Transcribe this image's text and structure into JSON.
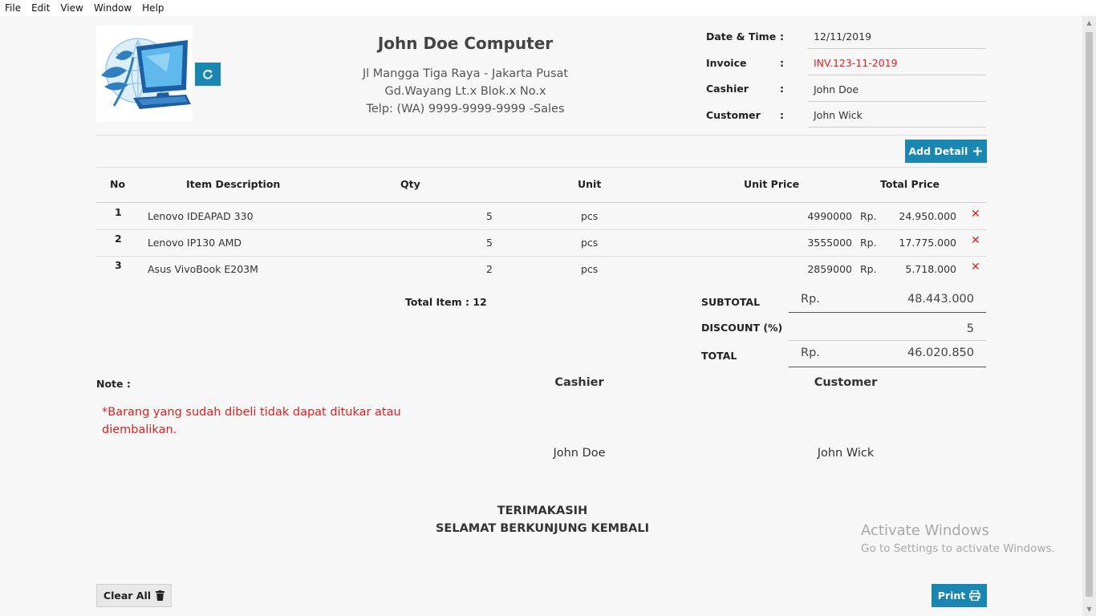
{
  "menu": [
    "File",
    "Edit",
    "View",
    "Window",
    "Help"
  ],
  "icons": {
    "refresh": "refresh-icon",
    "add": "plus-icon",
    "delete": "close-icon",
    "clear": "trash-icon",
    "print": "printer-icon",
    "logo": "computer-logo-icon"
  },
  "colors": {
    "accent": "#1a87b3",
    "danger": "#e02020"
  },
  "header": {
    "company_name": "John Doe Computer",
    "address_line1": "Jl Mangga Tiga Raya - Jakarta Pusat",
    "address_line2": "Gd.Wayang Lt.x Blok.x No.x",
    "phone": "Telp: (WA) 9999-9999-9999 -Sales"
  },
  "info": {
    "date_label": "Date & Time",
    "date_value": "12/11/2019",
    "invoice_label": "Invoice",
    "invoice_value": "INV.123-11-2019",
    "cashier_label": "Cashier",
    "cashier_value": "John Doe",
    "customer_label": "Customer",
    "customer_value": "John Wick",
    "colon": ":"
  },
  "buttons": {
    "add_detail": "Add Detail",
    "clear_all": "Clear All",
    "print": "Print"
  },
  "table": {
    "headers": {
      "no": "No",
      "desc": "Item Description",
      "qty": "Qty",
      "unit": "Unit",
      "unit_price": "Unit Price",
      "total_price": "Total Price"
    },
    "rows": [
      {
        "no": "1",
        "desc": "Lenovo IDEAPAD 330",
        "qty": "5",
        "unit": "pcs",
        "unit_price": "4990000",
        "rp": "Rp.",
        "total": "24.950.000"
      },
      {
        "no": "2",
        "desc": "Lenovo IP130 AMD",
        "qty": "5",
        "unit": "pcs",
        "unit_price": "3555000",
        "rp": "Rp.",
        "total": "17.775.000"
      },
      {
        "no": "3",
        "desc": "Asus VivoBook E203M",
        "qty": "2",
        "unit": "pcs",
        "unit_price": "2859000",
        "rp": "Rp.",
        "total": "5.718.000"
      }
    ]
  },
  "totals": {
    "total_item": "Total Item : 12",
    "subtotal_label": "SUBTOTAL",
    "subtotal_rp": "Rp.",
    "subtotal_value": "48.443.000",
    "discount_label": "DISCOUNT (%)",
    "discount_value": "5",
    "total_label": "TOTAL",
    "total_rp": "Rp.",
    "total_value": "46.020.850"
  },
  "note": {
    "label": "Note :",
    "text": "*Barang yang sudah dibeli tidak dapat ditukar atau diembalikan."
  },
  "signatures": {
    "cashier_title": "Cashier",
    "cashier_name": "John Doe",
    "customer_title": "Customer",
    "customer_name": "John Wick"
  },
  "footer": {
    "line1": "TERIMAKASIH",
    "line2": "SELAMAT BERKUNJUNG KEMBALI"
  },
  "watermark": {
    "line1": "Activate Windows",
    "line2": "Go to Settings to activate Windows."
  }
}
